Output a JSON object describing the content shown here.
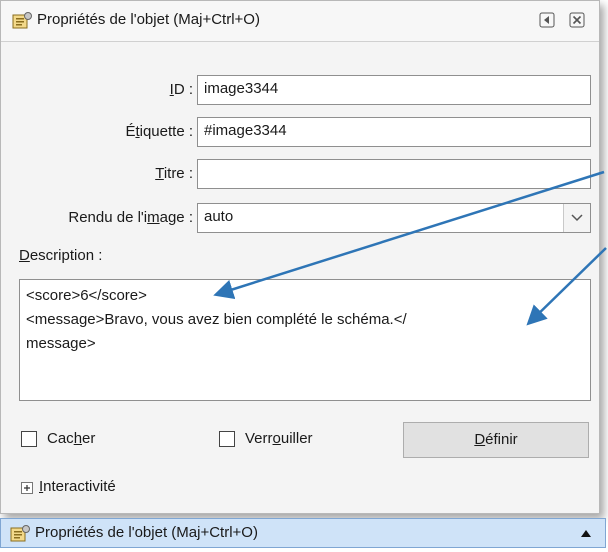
{
  "window": {
    "title": "Propriétés de l'objet (Maj+Ctrl+O)"
  },
  "fields": {
    "id_label_pre": "",
    "id_label_u": "I",
    "id_label_post": "D :",
    "id_value": "image3344",
    "label_label_pre": "É",
    "label_label_u": "t",
    "label_label_post": "iquette :",
    "label_value": "#image3344",
    "title_label_pre": "",
    "title_label_u": "T",
    "title_label_post": "itre :",
    "title_value": "",
    "render_label_pre": "Rendu de l'i",
    "render_label_u": "m",
    "render_label_post": "age :",
    "render_value": "auto"
  },
  "description": {
    "label_u": "D",
    "label_post": "escription :",
    "line1": "<score>6</score>",
    "line2": "<message>Bravo, vous avez  bien complété le schéma.</",
    "line3": "message>"
  },
  "options": {
    "hide_pre": "Cac",
    "hide_u": "h",
    "hide_post": "er",
    "hide_checked": false,
    "lock_pre": "Verr",
    "lock_u": "o",
    "lock_post": "uiller",
    "lock_checked": false,
    "define_u": "D",
    "define_post": "éfinir"
  },
  "interactivity": {
    "label_u": "I",
    "label_post": "nteractivité",
    "expanded": false
  },
  "footer": {
    "title": "Propriétés de l'objet (Maj+Ctrl+O)"
  },
  "icons": {
    "title_icon": "object-properties-icon",
    "arrow_icon": "collapse-arrow-icon",
    "close_icon": "close-icon",
    "select_icon": "chevron-down-icon",
    "expand_icon": "plus-box-icon",
    "footer_arrow": "triangle-up-icon"
  },
  "colors": {
    "annotation_arrow": "#2e75b6",
    "footer_bg": "#cfe3f8"
  }
}
